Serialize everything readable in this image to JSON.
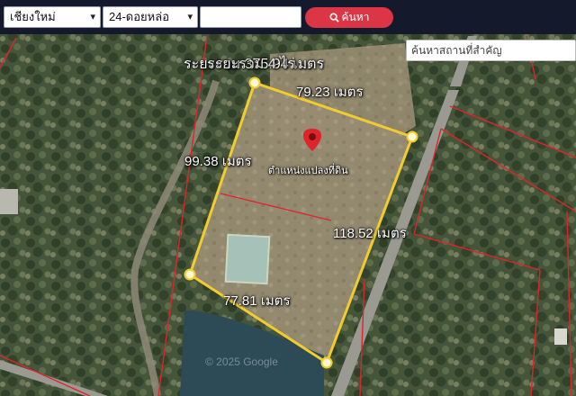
{
  "toolbar": {
    "province": "เชียงใหม่",
    "district": "24-ดอยหล่อ",
    "search_value": "",
    "search_button": "ค้นหา"
  },
  "map": {
    "place_search_placeholder": "ค้นหาสถานที่สำคัญ",
    "area_label": "ระยะรวม 375.94 เมตร",
    "area_overlay": "ระยะรวม 4 ไร่ ...",
    "pin_caption": "ตำแหน่งแปลงที่ดิน",
    "edges": [
      {
        "label": "79.23 เมตร"
      },
      {
        "label": "99.38 เมตร"
      },
      {
        "label": "118.52 เมตร"
      },
      {
        "label": "77.81 เมตร"
      }
    ],
    "watermark": "© 2025 Google",
    "colors": {
      "parcel_outline": "#f2cc2e",
      "cadastral_lines": "#e0242b",
      "pin": "#e0242b",
      "search_button": "#dc3545",
      "header": "#14192b"
    },
    "icons": [
      "search-icon",
      "map-pin-icon",
      "chevron-down-icon"
    ]
  }
}
